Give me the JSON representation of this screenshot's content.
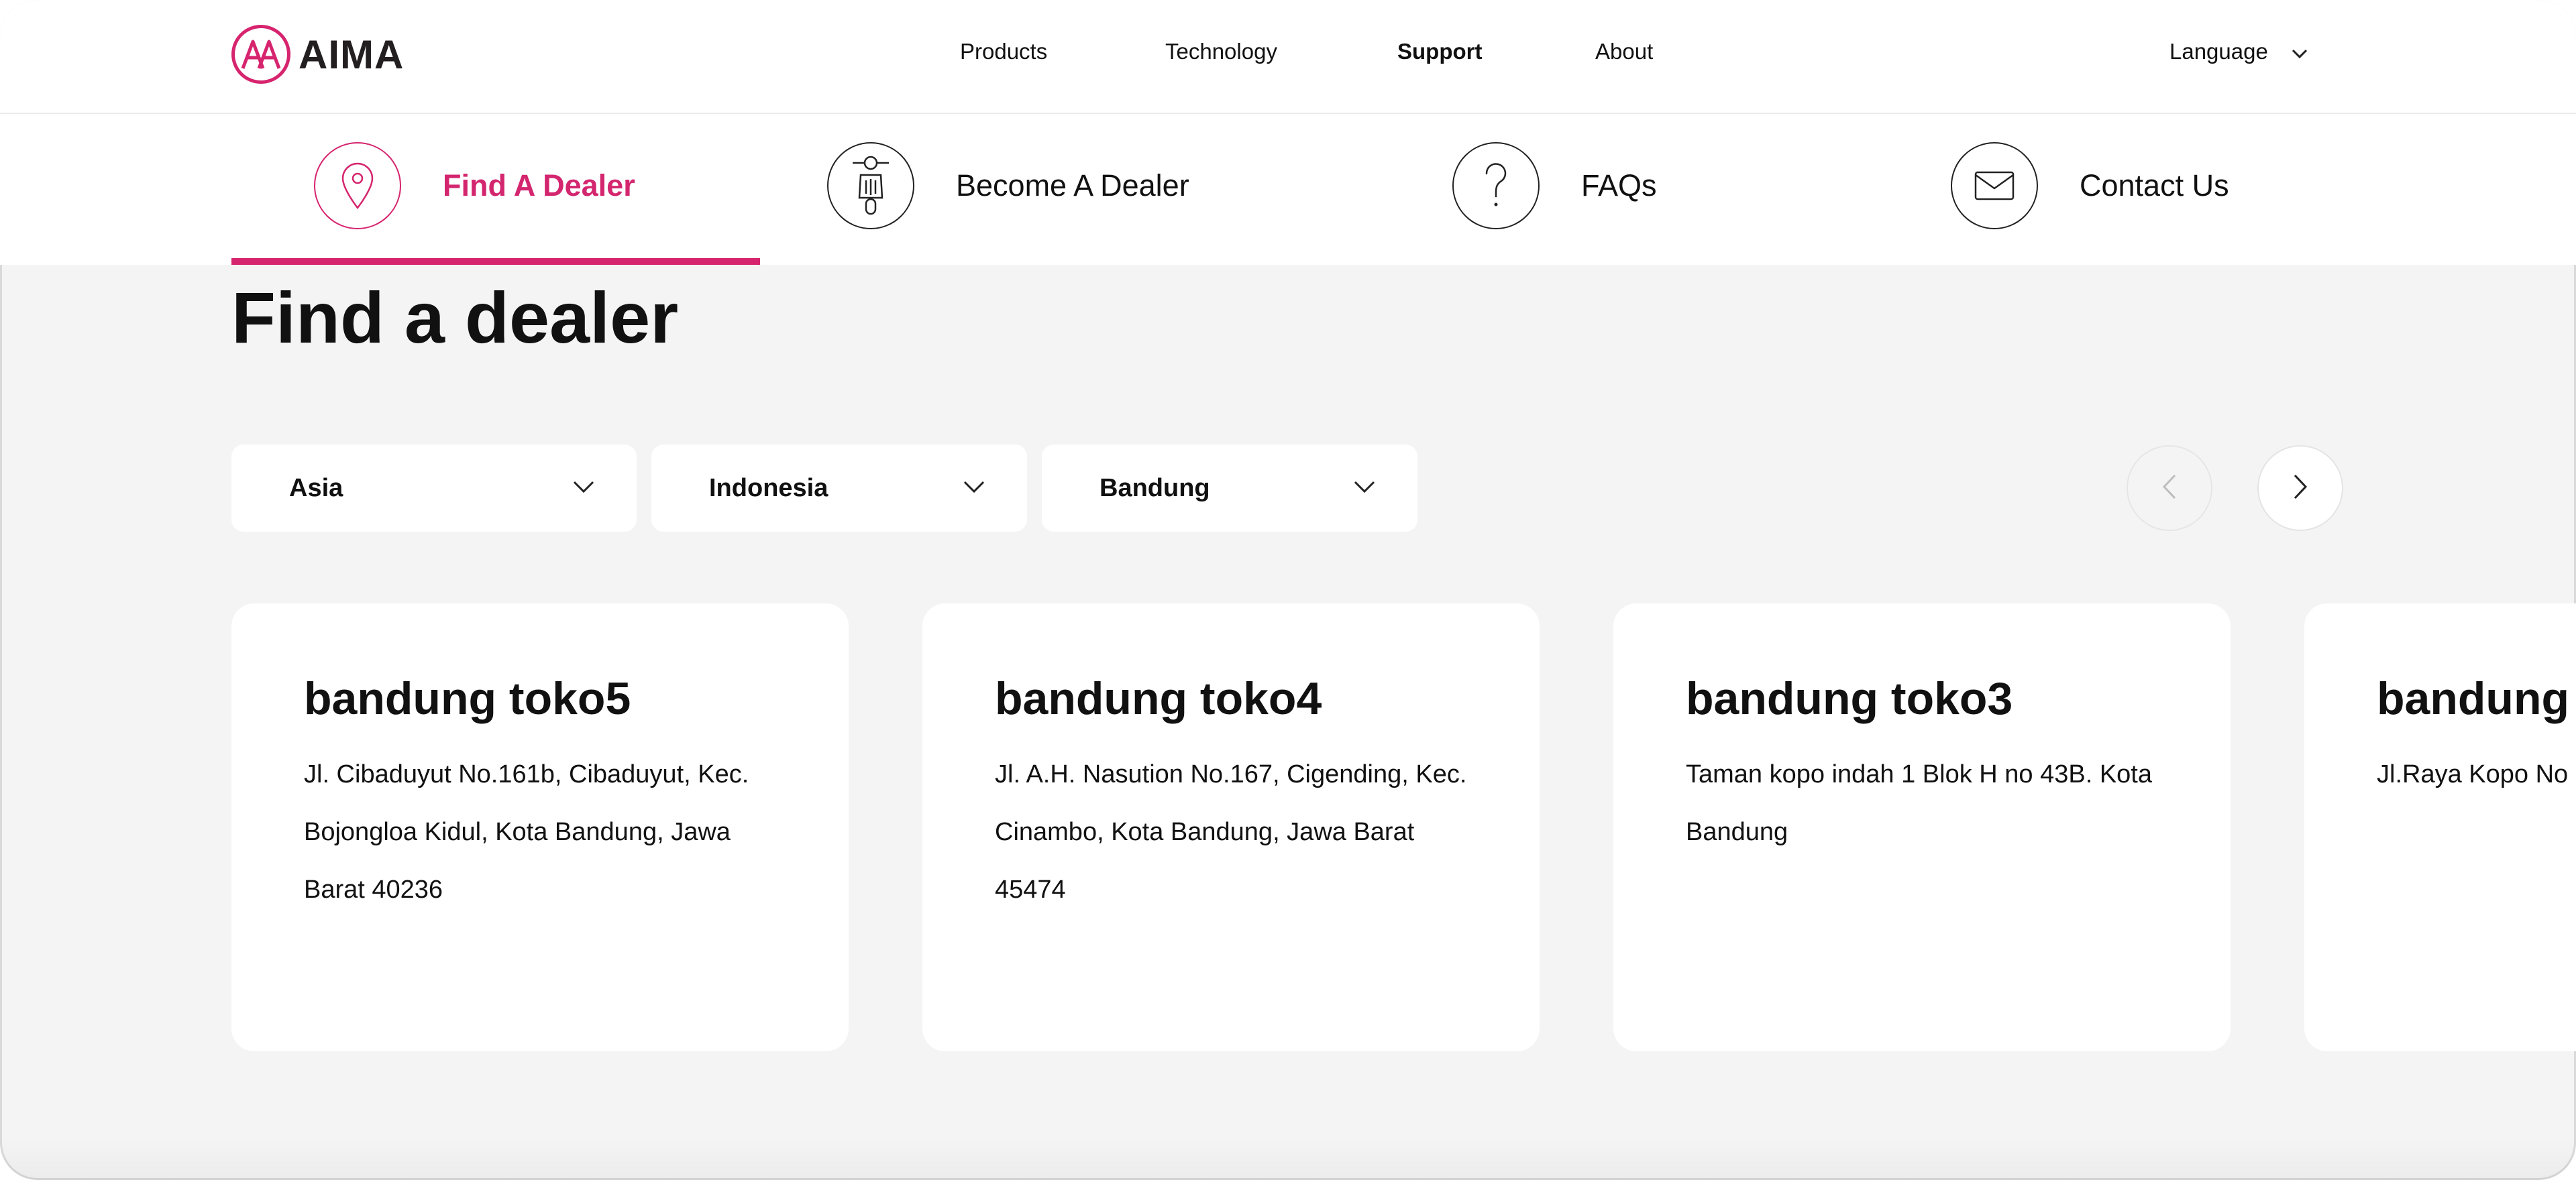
{
  "brand": {
    "name": "AIMA",
    "accent": "#d6246e"
  },
  "nav": {
    "links": [
      {
        "label": "Products",
        "active": false
      },
      {
        "label": "Technology",
        "active": false
      },
      {
        "label": "Support",
        "active": true
      },
      {
        "label": "About",
        "active": false
      }
    ],
    "language_label": "Language"
  },
  "subnav": {
    "tabs": [
      {
        "label": "Find A Dealer",
        "icon": "location-pin-icon",
        "active": true
      },
      {
        "label": "Become A Dealer",
        "icon": "scooter-rider-icon",
        "active": false
      },
      {
        "label": "FAQs",
        "icon": "question-mark-icon",
        "active": false
      },
      {
        "label": "Contact Us",
        "icon": "envelope-icon",
        "active": false
      }
    ]
  },
  "page": {
    "title": "Find a dealer"
  },
  "filters": {
    "region": "Asia",
    "country": "Indonesia",
    "city": "Bandung"
  },
  "carousel": {
    "prev_disabled": true,
    "next_disabled": false
  },
  "dealers": [
    {
      "name": "bandung toko5",
      "address": "Jl. Cibaduyut No.161b, Cibaduyut, Kec. Bojongloa Kidul, Kota Bandung, Jawa Barat 40236"
    },
    {
      "name": "bandung toko4",
      "address": "Jl. A.H. Nasution No.167, Cigending, Kec. Cinambo, Kota Bandung, Jawa Barat 45474"
    },
    {
      "name": "bandung toko3",
      "address": "Taman kopo indah 1 Blok H no 43B. Kota Bandung"
    },
    {
      "name": "bandung",
      "address": "Jl.Raya Kopo No"
    }
  ]
}
